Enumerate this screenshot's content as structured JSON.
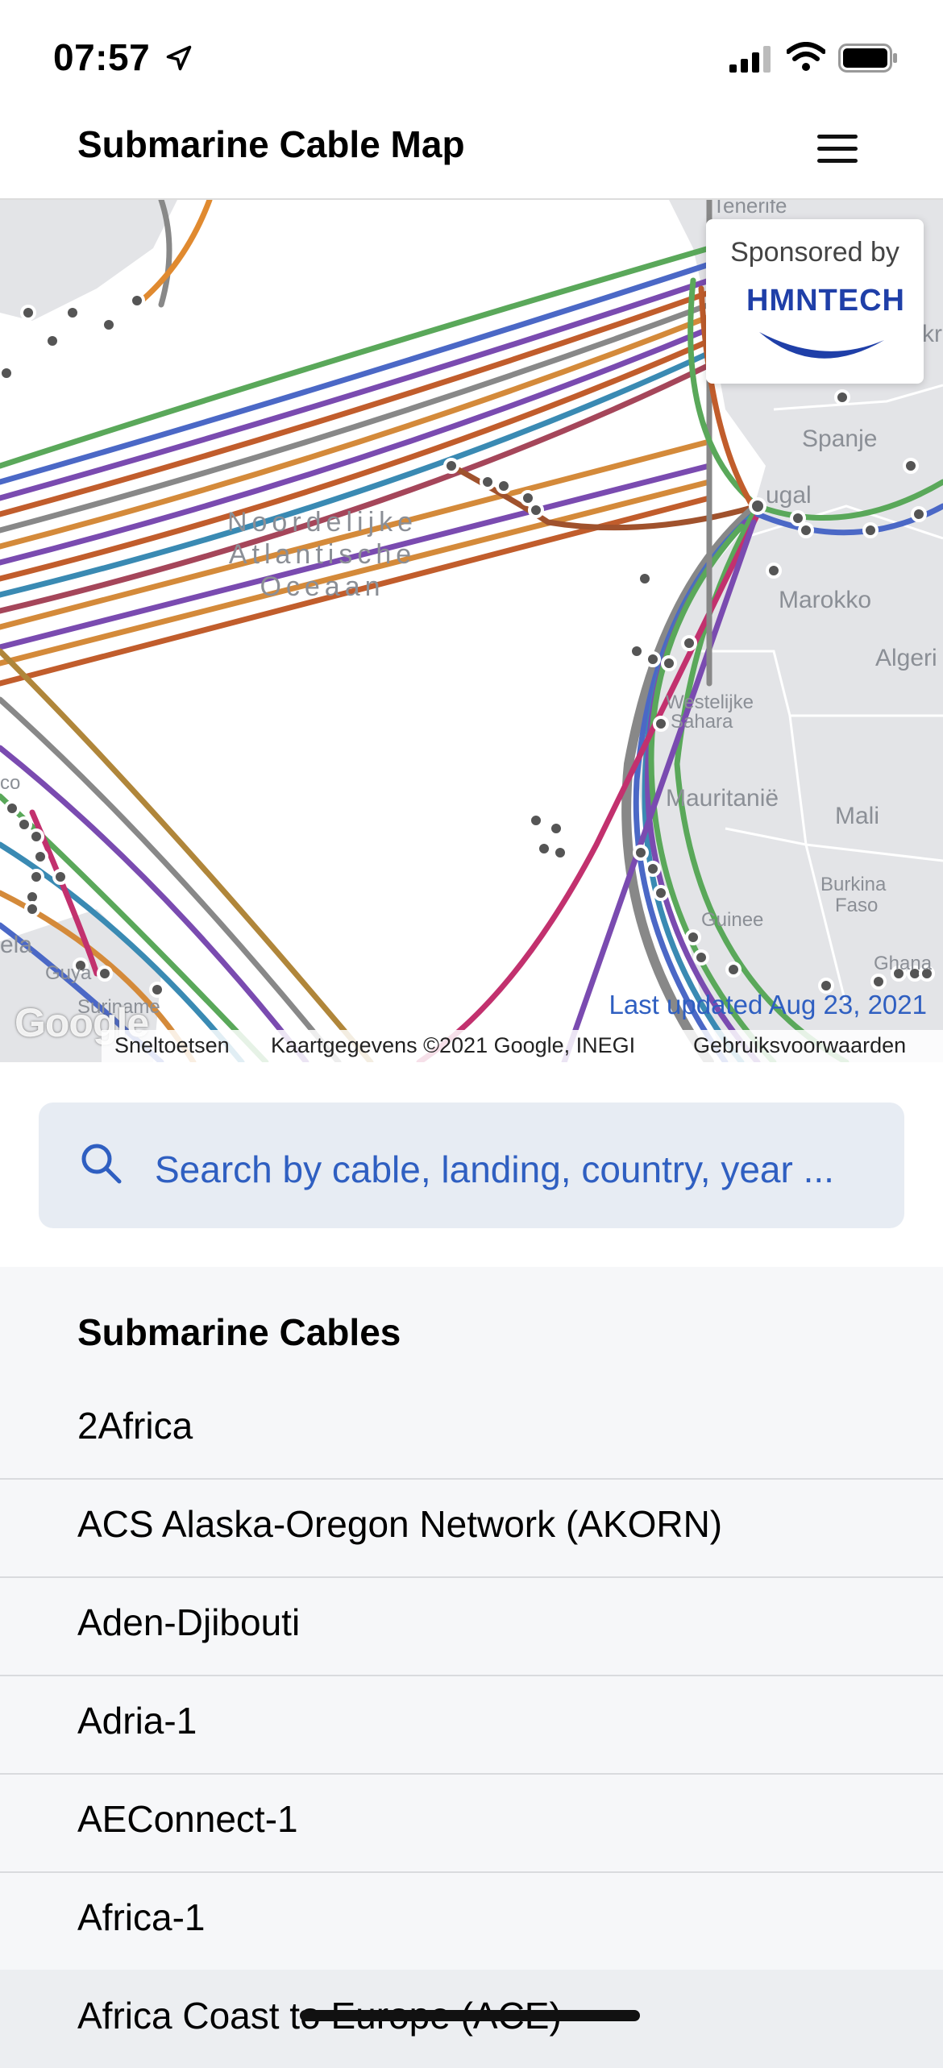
{
  "status_bar": {
    "time": "07:57"
  },
  "header": {
    "title": "Submarine Cable Map"
  },
  "map": {
    "ocean_label": [
      "Noordelijke",
      "Atlantische",
      "Oceaan"
    ],
    "countries": [
      "Spanje",
      "Marokko",
      "Algeri",
      "Westelijke",
      "Sahara",
      "Mauritanië",
      "Mali",
      "Burkina",
      "Faso",
      "Guinee",
      "Ghana",
      "Suriname",
      "Guya",
      "ela",
      "co",
      "Tenerife",
      "kr",
      "ugal"
    ],
    "sponsor": {
      "label": "Sponsored by",
      "brand": "HMNTECH",
      "brand_color": "#1f3fa8"
    },
    "last_updated": "Last updated Aug 23, 2021",
    "google_logo": "Google",
    "attribution": {
      "shortcuts": "Sneltoetsen",
      "map_data": "Kaartgegevens ©2021 Google, INEGI",
      "terms": "Gebruiksvoorwaarden"
    }
  },
  "search": {
    "placeholder": "Search by cable, landing, country, year ..."
  },
  "cables": {
    "heading": "Submarine Cables",
    "items": [
      "2Africa",
      "ACS Alaska-Oregon Network (AKORN)",
      "Aden-Djibouti",
      "Adria-1",
      "AEConnect-1",
      "Africa-1",
      "Africa Coast to Europe (ACE)"
    ]
  },
  "colors": {
    "accent": "#2f5fc1",
    "search_bg": "#e7ecf3",
    "list_bg": "#f6f7f9"
  }
}
